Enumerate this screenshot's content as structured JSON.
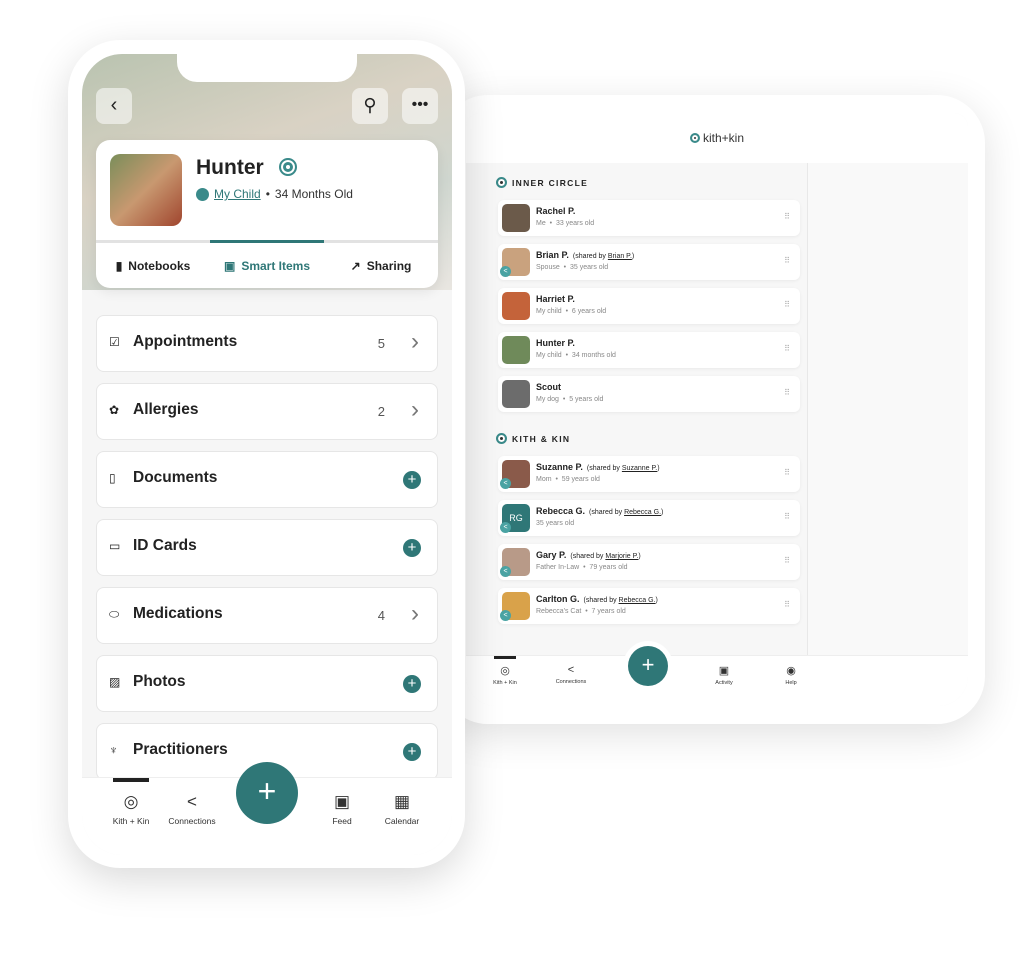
{
  "colors": {
    "accent": "#2f7777"
  },
  "tablet": {
    "logo": "kith+kin",
    "inner_circle": {
      "title": "INNER CIRCLE",
      "rows": [
        {
          "name": "Rachel P.",
          "shared_by": "",
          "relation": "Me",
          "age": "33 years old",
          "shared": false
        },
        {
          "name": "Brian P.",
          "shared_by": "Brian P.",
          "relation": "Spouse",
          "age": "35 years old",
          "shared": true
        },
        {
          "name": "Harriet P.",
          "shared_by": "",
          "relation": "My child",
          "age": "6 years old",
          "shared": false
        },
        {
          "name": "Hunter P.",
          "shared_by": "",
          "relation": "My child",
          "age": "34 months old",
          "shared": false
        },
        {
          "name": "Scout",
          "shared_by": "",
          "relation": "My dog",
          "age": "5 years old",
          "shared": false
        }
      ]
    },
    "kith_kin": {
      "title": "KITH & KIN",
      "rows": [
        {
          "name": "Suzanne P.",
          "shared_by": "Suzanne P.",
          "relation": "Mom",
          "age": "59 years old",
          "shared": true
        },
        {
          "name": "Rebecca G.",
          "shared_by": "Rebecca G.",
          "relation": "",
          "age": "35 years old",
          "shared": true,
          "initials": "RG"
        },
        {
          "name": "Gary P.",
          "shared_by": "Marjorie P.",
          "relation": "Father In-Law",
          "age": "79 years old",
          "shared": true
        },
        {
          "name": "Carlton G.",
          "shared_by": "Rebecca G.",
          "relation": "Rebecca's Cat",
          "age": "7 years old",
          "shared": true
        }
      ]
    },
    "shared_by_prefix": "(shared by ",
    "shared_by_suffix": ")",
    "nav": [
      {
        "label": "Kith + Kin",
        "icon": "kith-kin-icon"
      },
      {
        "label": "Connections",
        "icon": "share-icon"
      },
      {
        "label": "Activity",
        "icon": "activity-icon"
      },
      {
        "label": "Help",
        "icon": "help-icon"
      }
    ],
    "fab": "+"
  },
  "phone": {
    "profile": {
      "name": "Hunter",
      "relation": "My Child",
      "age": "34 Months Old"
    },
    "tabs": [
      {
        "label": "Notebooks",
        "icon": "notebook-icon",
        "active": false
      },
      {
        "label": "Smart Items",
        "icon": "smart-items-icon",
        "active": true
      },
      {
        "label": "Sharing",
        "icon": "share-out-icon",
        "active": false
      }
    ],
    "items": [
      {
        "label": "Appointments",
        "icon": "calendar-check-icon",
        "count": "5"
      },
      {
        "label": "Allergies",
        "icon": "allergy-icon",
        "count": "2"
      },
      {
        "label": "Documents",
        "icon": "document-icon",
        "count": ""
      },
      {
        "label": "ID Cards",
        "icon": "id-card-icon",
        "count": ""
      },
      {
        "label": "Medications",
        "icon": "pill-icon",
        "count": "4"
      },
      {
        "label": "Photos",
        "icon": "photo-icon",
        "count": ""
      },
      {
        "label": "Practitioners",
        "icon": "stethoscope-icon",
        "count": ""
      }
    ],
    "nav": [
      {
        "label": "Kith + Kin",
        "icon": "kith-kin-icon"
      },
      {
        "label": "Connections",
        "icon": "share-icon"
      },
      {
        "label": "Feed",
        "icon": "feed-icon"
      },
      {
        "label": "Calendar",
        "icon": "calendar-icon"
      }
    ],
    "fab": "+"
  }
}
